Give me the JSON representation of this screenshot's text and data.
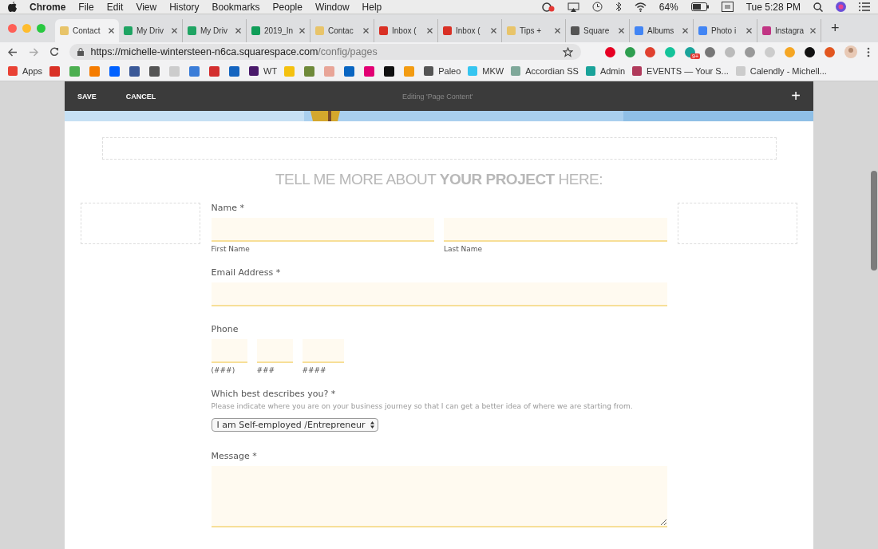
{
  "menu_bar": {
    "app": "Chrome",
    "items": [
      "File",
      "Edit",
      "View",
      "History",
      "Bookmarks",
      "People",
      "Window",
      "Help"
    ],
    "battery": "64%",
    "clock": "Tue 5:28 PM"
  },
  "tabs": [
    {
      "label": "Contact",
      "selected": true,
      "color": "#e8c46a"
    },
    {
      "label": "My Driv",
      "selected": false,
      "color": "#1fa463"
    },
    {
      "label": "My Driv",
      "selected": false,
      "color": "#1fa463"
    },
    {
      "label": "2019_In",
      "selected": false,
      "color": "#0f9d58"
    },
    {
      "label": "Contac",
      "selected": false,
      "color": "#e8c46a"
    },
    {
      "label": "Inbox (",
      "selected": false,
      "color": "#d93025"
    },
    {
      "label": "Inbox (",
      "selected": false,
      "color": "#d93025"
    },
    {
      "label": "Tips +",
      "selected": false,
      "color": "#e8c46a"
    },
    {
      "label": "Square",
      "selected": false,
      "color": "#555555"
    },
    {
      "label": "Albums",
      "selected": false,
      "color": "#4285f4"
    },
    {
      "label": "Photo i",
      "selected": false,
      "color": "#4285f4"
    },
    {
      "label": "Instagra",
      "selected": false,
      "color": "#c13584"
    }
  ],
  "new_tab": "+",
  "address": {
    "host": "https://michelle-wintersteen-n6ca.squarespace.com",
    "path": "/config/pages"
  },
  "extensions": [
    {
      "color": "#e60023"
    },
    {
      "color": "#2e9e4f"
    },
    {
      "color": "#e0402f"
    },
    {
      "color": "#15c39a"
    },
    {
      "color": "#1aa39a",
      "badge": "9+"
    },
    {
      "color": "#777777"
    },
    {
      "color": "#bbbbbb"
    },
    {
      "color": "#999999"
    },
    {
      "color": "#cccccc"
    },
    {
      "color": "#f5a623"
    },
    {
      "color": "#111111"
    },
    {
      "color": "#e2561f"
    }
  ],
  "bookmarks": [
    {
      "kind": "labeled",
      "label": "Apps",
      "color": "#e94235"
    },
    {
      "kind": "icon",
      "color": "#d93025"
    },
    {
      "kind": "icon",
      "color": "#4caf50"
    },
    {
      "kind": "icon",
      "color": "#f57c00"
    },
    {
      "kind": "icon",
      "color": "#0061ff"
    },
    {
      "kind": "icon",
      "color": "#3b5998"
    },
    {
      "kind": "icon",
      "color": "#555555"
    },
    {
      "kind": "icon",
      "color": "#cccccc"
    },
    {
      "kind": "icon",
      "color": "#3b7dd8"
    },
    {
      "kind": "icon",
      "color": "#d32f2f"
    },
    {
      "kind": "icon",
      "color": "#1565c0"
    },
    {
      "kind": "labeled",
      "label": "WT",
      "color": "#4a1a6b"
    },
    {
      "kind": "icon",
      "color": "#f4c10f"
    },
    {
      "kind": "icon",
      "color": "#6f8a3a"
    },
    {
      "kind": "icon",
      "color": "#e8a598"
    },
    {
      "kind": "icon",
      "color": "#0a66c2"
    },
    {
      "kind": "icon",
      "color": "#e20074"
    },
    {
      "kind": "icon",
      "color": "#111111"
    },
    {
      "kind": "icon",
      "color": "#f39c12"
    },
    {
      "kind": "labeled",
      "label": "Paleo",
      "color": "#555555"
    },
    {
      "kind": "labeled",
      "label": "MKW",
      "color": "#36c5f0"
    },
    {
      "kind": "labeled",
      "label": "Accordian SS",
      "color": "#7fa89a"
    },
    {
      "kind": "labeled",
      "label": "Admin",
      "color": "#1aa39a"
    },
    {
      "kind": "labeled",
      "label": "EVENTS — Your S...",
      "color": "#b03a5b"
    },
    {
      "kind": "labeled",
      "label": "Calendly - Michell...",
      "color": "#cccccc"
    }
  ],
  "editor_bar": {
    "save": "SAVE",
    "cancel": "CANCEL",
    "title": "Editing 'Page Content'",
    "add": "+"
  },
  "form": {
    "heading": "TELL ME MORE ABOUT **YOUR PROJECT** HERE:",
    "name": {
      "label": "Name",
      "required": "*",
      "first": "First Name",
      "last": "Last Name"
    },
    "email": {
      "label": "Email Address",
      "required": "*"
    },
    "phone": {
      "label": "Phone",
      "parts": [
        "(###)",
        "###",
        "####"
      ]
    },
    "describe": {
      "label": "Which best describes you?",
      "required": "*",
      "help": "Please indicate where you are on your business journey so that I can get a better idea of where we are starting from.",
      "value": "I am Self-employed /Entrepreneur"
    },
    "message": {
      "label": "Message",
      "required": "*"
    }
  }
}
